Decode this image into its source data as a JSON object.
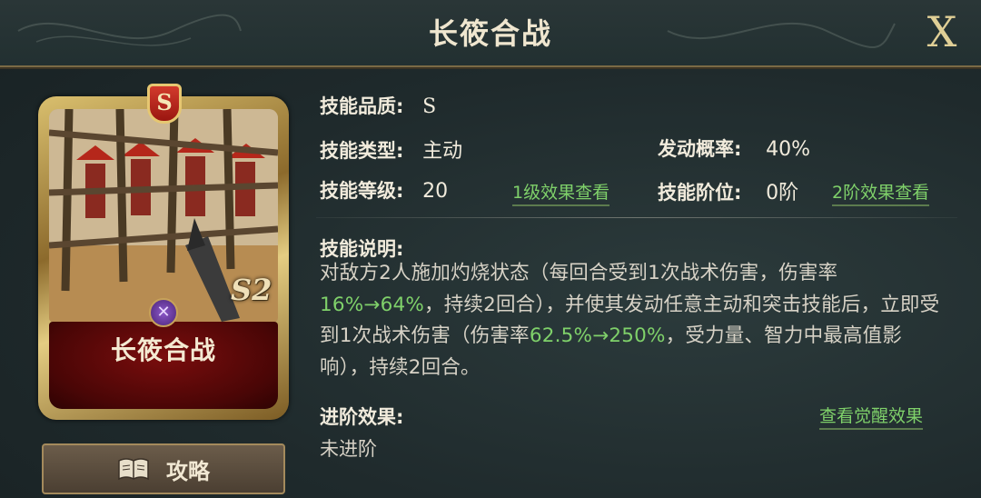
{
  "header": {
    "title": "长筱合战",
    "close_label": "X"
  },
  "card": {
    "grade_badge": "S",
    "name": "长筱合战",
    "level_mark": "S2",
    "type_icon": "active-skill-icon"
  },
  "guide_button": {
    "label": "攻略",
    "icon": "book-icon"
  },
  "info": {
    "quality_label": "技能品质:",
    "quality_value": "S",
    "type_label": "技能类型:",
    "type_value": "主动",
    "trigger_label": "发动概率:",
    "trigger_value": "40%",
    "level_label": "技能等级:",
    "level_value": "20",
    "level1_link": "1级效果查看",
    "tier_label": "技能阶位:",
    "tier_value": "0阶",
    "tier2_link": "2阶效果查看"
  },
  "description": {
    "label": "技能说明:",
    "text_1": "对敌方2人施加灼烧状态（每回合受到1次战术伤害，伤害率",
    "hl_1": "16%→64%",
    "text_2": "，持续2回合），并使其发动任意主动和突击技能后，立即受到1次战术伤害（伤害率",
    "hl_2": "62.5%→250%",
    "text_3": "，受力量、智力中最高值影响），持续2回合。"
  },
  "advance": {
    "label": "进阶效果:",
    "link": "查看觉醒效果",
    "value": "未进阶"
  },
  "colors": {
    "highlight_green": "#7fd16a",
    "card_red": "#7a0d0d",
    "gold_frame": "#d9bf6e"
  }
}
